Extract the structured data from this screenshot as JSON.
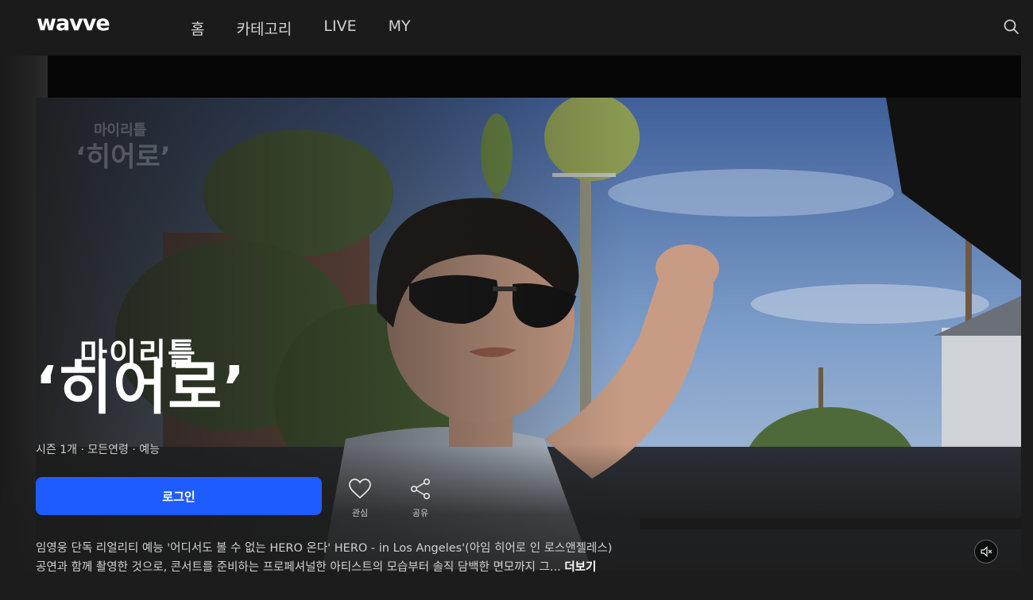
{
  "header": {
    "logo": "wavve",
    "nav": [
      {
        "label": "홈"
      },
      {
        "label": "카테고리"
      },
      {
        "label": "LIVE"
      },
      {
        "label": "MY"
      }
    ],
    "search_icon": "search-icon"
  },
  "hero": {
    "title_small": "마이리틀",
    "title_big": "‘히어로’",
    "ghost_title_small": "마이리틀",
    "ghost_title_big": "‘히어로’",
    "meta": "시즌 1개 · 모든연령 · 예능",
    "login_label": "로그인",
    "favorite_label": "관심",
    "share_label": "공유",
    "description_line1": "임영웅 단독 리얼리티 예능 '어디서도 볼 수 없는 HERO 온다' HERO - in Los Angeles'(아임 히어로 인 로스앤젤레스)",
    "description_line2": "공연과 함께 촬영한 것으로, 콘서트를 준비하는 프로페셔널한 아티스트의 모습부터 솔직 담백한 면모까지 그... ",
    "more_label": "더보기",
    "mute_icon": "mute-icon"
  },
  "colors": {
    "accent": "#1f5cff",
    "background": "#1c1c1c"
  }
}
